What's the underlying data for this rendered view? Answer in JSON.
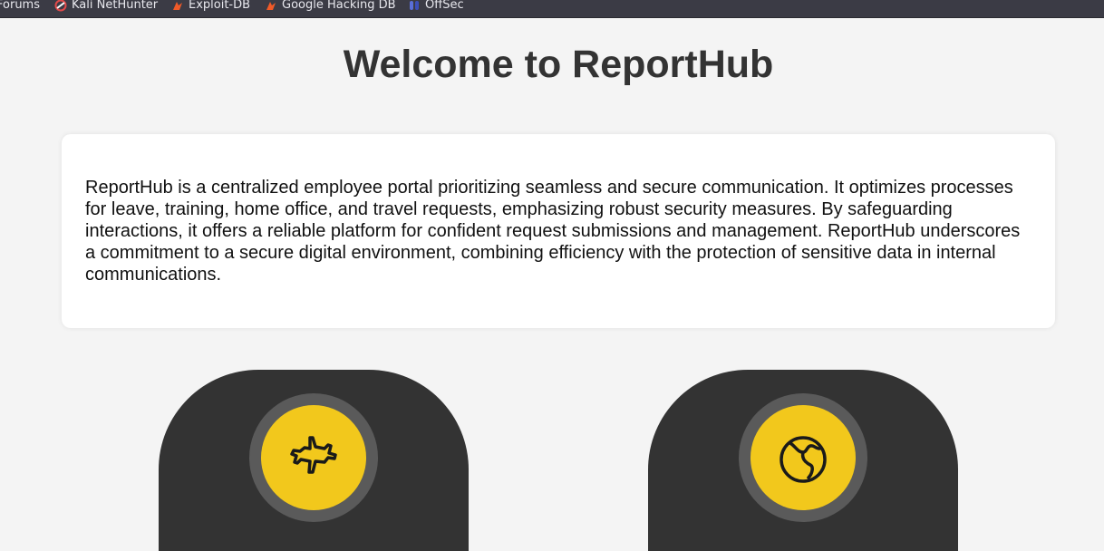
{
  "bookmarks": [
    {
      "label": "Forums",
      "icon": "none"
    },
    {
      "label": "Kali NetHunter",
      "icon": "nethunter-icon"
    },
    {
      "label": "Exploit-DB",
      "icon": "exploit-db-icon"
    },
    {
      "label": "Google Hacking DB",
      "icon": "exploit-db-icon"
    },
    {
      "label": "OffSec",
      "icon": "offsec-icon"
    }
  ],
  "page": {
    "title": "Welcome to ReportHub",
    "about": "ReportHub is a centralized employee portal prioritizing seamless and secure communication. It optimizes processes for leave, training, home office, and travel requests, emphasizing robust security measures. By safeguarding interactions, it offers a reliable platform for confident request submissions and management. ReportHub underscores a commitment to a secure digital environment, combining efficiency with the protection of sensitive data in internal communications."
  },
  "services": [
    {
      "icon": "airplane-icon"
    },
    {
      "icon": "globe-icon"
    }
  ],
  "colors": {
    "accent": "#f2c81c",
    "card_dark": "#333333",
    "bookmark_bar": "#3b3b45"
  }
}
